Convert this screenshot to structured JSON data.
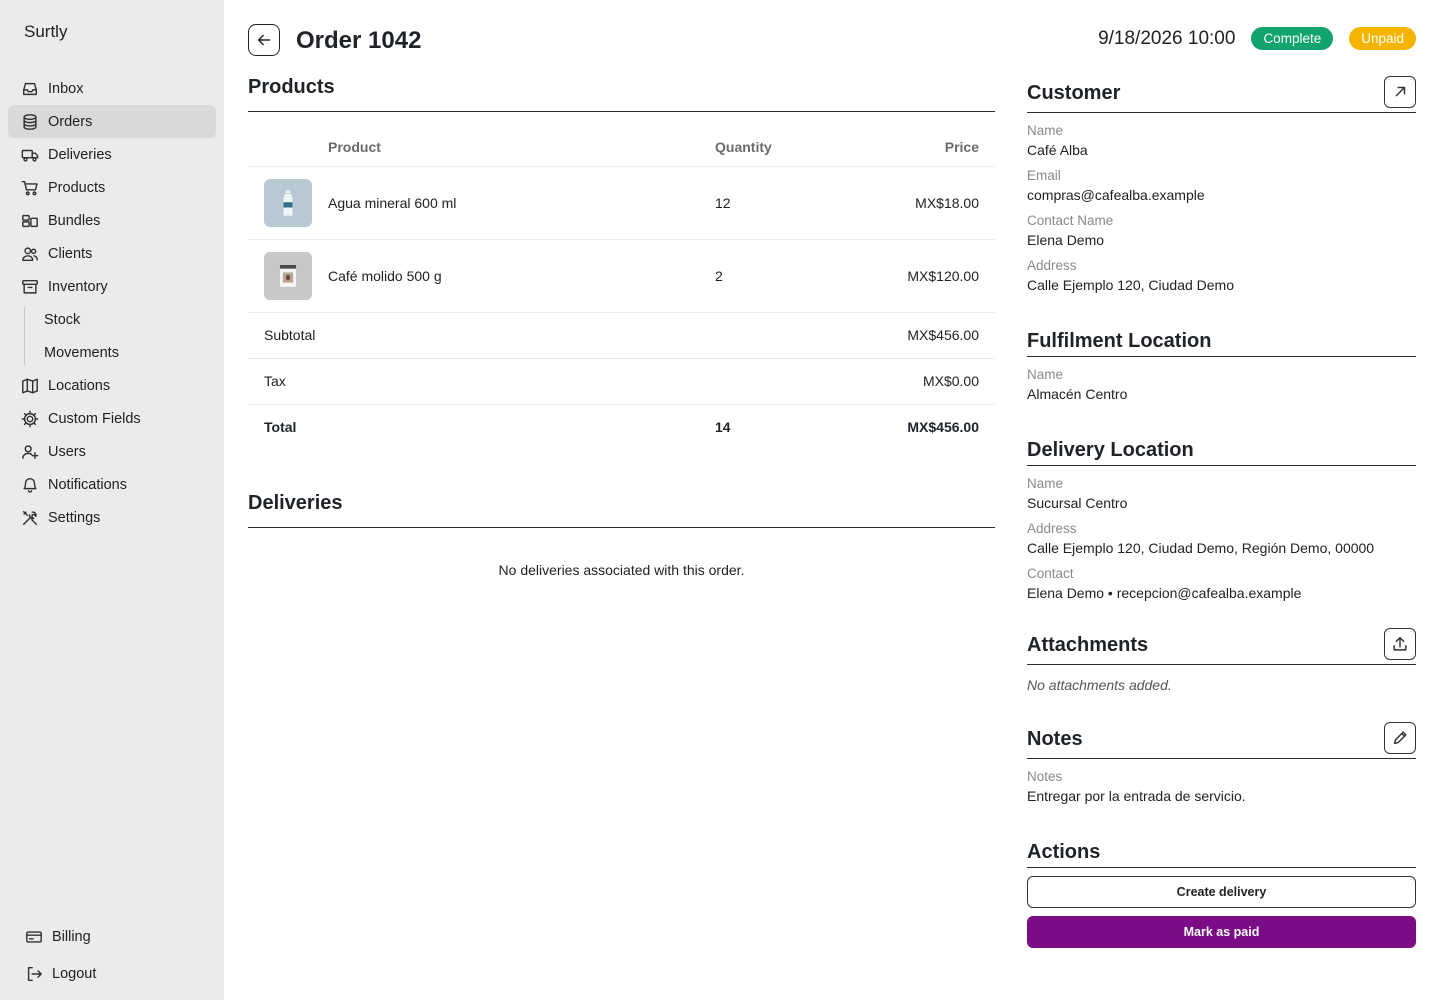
{
  "app": {
    "brand": "Surtly"
  },
  "sidebar": {
    "items": [
      {
        "label": "Inbox",
        "icon": "inbox-icon"
      },
      {
        "label": "Orders",
        "icon": "database-icon",
        "active": true
      },
      {
        "label": "Deliveries",
        "icon": "truck-icon"
      },
      {
        "label": "Products",
        "icon": "cart-icon"
      },
      {
        "label": "Bundles",
        "icon": "bundles-icon"
      },
      {
        "label": "Clients",
        "icon": "users-icon"
      },
      {
        "label": "Inventory",
        "icon": "archive-icon"
      }
    ],
    "inventory_sub": [
      {
        "label": "Stock"
      },
      {
        "label": "Movements"
      }
    ],
    "items2": [
      {
        "label": "Locations",
        "icon": "map-icon"
      },
      {
        "label": "Custom Fields",
        "icon": "cog-icon"
      },
      {
        "label": "Users",
        "icon": "user-plus-icon"
      },
      {
        "label": "Notifications",
        "icon": "bell-icon"
      },
      {
        "label": "Settings",
        "icon": "tools-icon"
      }
    ],
    "bottom": [
      {
        "label": "Billing",
        "icon": "credit-card-icon"
      },
      {
        "label": "Logout",
        "icon": "logout-icon"
      }
    ]
  },
  "header": {
    "title": "Order 1042",
    "datetime": "9/18/2026 10:00",
    "status_badge": "Complete",
    "payment_badge": "Unpaid",
    "colors": {
      "complete": "#12a46f",
      "unpaid": "#f5b400"
    }
  },
  "products": {
    "title": "Products",
    "columns": {
      "product": "Product",
      "quantity": "Quantity",
      "price": "Price"
    },
    "rows": [
      {
        "name": "Agua mineral 600 ml",
        "quantity": "12",
        "price": "MX$18.00",
        "thumb": "water-bottle-icon"
      },
      {
        "name": "Café molido 500 g",
        "quantity": "2",
        "price": "MX$120.00",
        "thumb": "coffee-bag-icon"
      }
    ],
    "subtotal": {
      "label": "Subtotal",
      "value": "MX$456.00"
    },
    "tax": {
      "label": "Tax",
      "value": "MX$0.00"
    },
    "total": {
      "label": "Total",
      "quantity": "14",
      "value": "MX$456.00"
    }
  },
  "deliveries": {
    "title": "Deliveries",
    "empty": "No deliveries associated with this order."
  },
  "customer": {
    "title": "Customer",
    "fields": [
      {
        "label": "Name",
        "value": "Café Alba"
      },
      {
        "label": "Email",
        "value": "compras@cafealba.example"
      },
      {
        "label": "Contact Name",
        "value": "Elena Demo"
      },
      {
        "label": "Address",
        "value": "Calle Ejemplo 120, Ciudad Demo"
      }
    ]
  },
  "fulfilment": {
    "title": "Fulfilment Location",
    "fields": [
      {
        "label": "Name",
        "value": "Almacén Centro"
      }
    ]
  },
  "delivery_location": {
    "title": "Delivery Location",
    "fields": [
      {
        "label": "Name",
        "value": "Sucursal Centro"
      },
      {
        "label": "Address",
        "value": "Calle Ejemplo 120, Ciudad Demo, Región Demo, 00000"
      },
      {
        "label": "Contact",
        "value": "Elena Demo • recepcion@cafealba.example"
      }
    ]
  },
  "attachments": {
    "title": "Attachments",
    "empty": "No attachments added."
  },
  "notes": {
    "title": "Notes",
    "label": "Notes",
    "value": "Entregar por la entrada de servicio."
  },
  "actions": {
    "title": "Actions",
    "create_delivery": "Create delivery",
    "mark_paid": "Mark as paid",
    "primary_color": "#7a0d86"
  }
}
